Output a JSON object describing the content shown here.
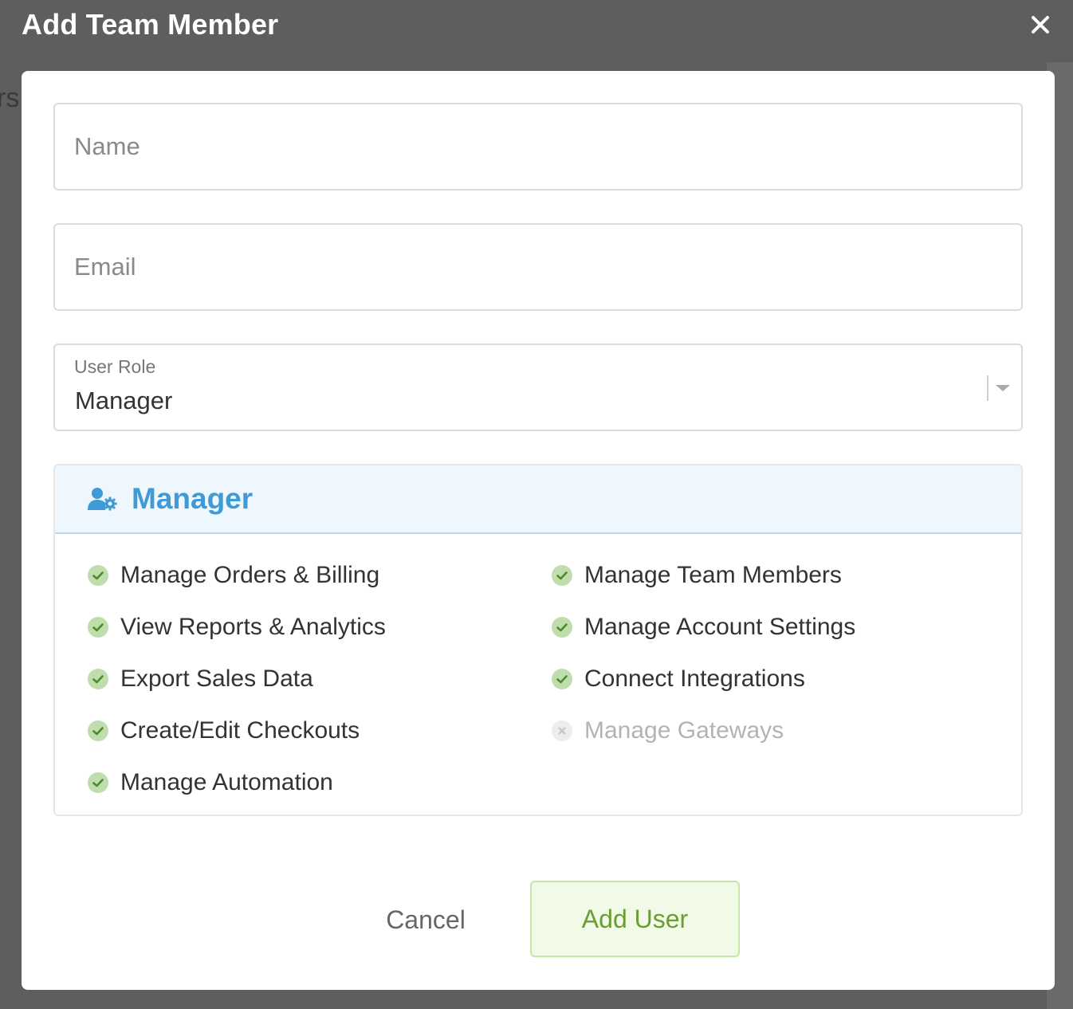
{
  "modal": {
    "title": "Add Team Member",
    "close_icon": "close-icon"
  },
  "background": {
    "partial_text": "rs"
  },
  "form": {
    "name": {
      "placeholder": "Name",
      "value": ""
    },
    "email": {
      "placeholder": "Email",
      "value": ""
    },
    "role": {
      "label": "User Role",
      "value": "Manager",
      "icon": "chevron-down-icon"
    }
  },
  "permissions": {
    "title": "Manager",
    "icon": "user-gear-icon",
    "colors": {
      "allowed": "#8dc26a",
      "denied": "#d9d9d9",
      "accent": "#3f9ad6"
    },
    "left": [
      {
        "label": "Manage Orders & Billing",
        "allowed": true
      },
      {
        "label": "View Reports & Analytics",
        "allowed": true
      },
      {
        "label": "Export Sales Data",
        "allowed": true
      },
      {
        "label": "Create/Edit Checkouts",
        "allowed": true
      },
      {
        "label": "Manage Automation",
        "allowed": true
      }
    ],
    "right": [
      {
        "label": "Manage Team Members",
        "allowed": true
      },
      {
        "label": "Manage Account Settings",
        "allowed": true
      },
      {
        "label": "Connect Integrations",
        "allowed": true
      },
      {
        "label": "Manage Gateways",
        "allowed": false
      }
    ]
  },
  "actions": {
    "cancel_label": "Cancel",
    "submit_label": "Add User"
  }
}
